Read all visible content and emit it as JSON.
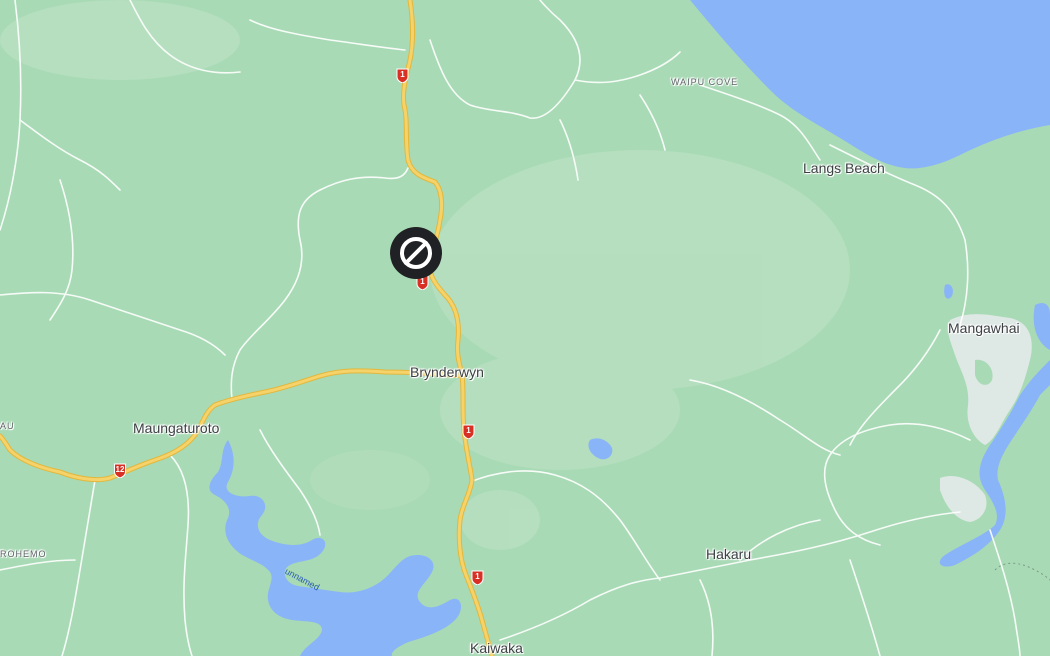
{
  "map": {
    "colors": {
      "land": "#a8dab5",
      "land_light": "#bfe3c6",
      "water": "#8ab4f8",
      "urban": "#e8eaed",
      "road_major": "#f5d36a",
      "road_major_edge": "#e3b73c",
      "road_minor": "#ffffff",
      "shield": "#d93025",
      "closure_marker": "#202124"
    },
    "places": {
      "waipu_cove": "WAIPU COVE",
      "langs_beach": "Langs Beach",
      "mangawhai": "Mangawhai",
      "brynderwyn": "Brynderwyn",
      "maungaturoto": "Maungaturoto",
      "hakaru": "Hakaru",
      "kaiwaka": "Kaiwaka",
      "rohemo": "ROHEMO",
      "au": "AU"
    },
    "water_labels": {
      "unnamed": "unnamed"
    },
    "route_shields": {
      "sh1_a": "1",
      "sh1_b": "1",
      "sh1_c": "1",
      "sh1_d": "1",
      "sh12": "12"
    },
    "markers": {
      "road_closure_icon": "no-entry-icon"
    }
  }
}
